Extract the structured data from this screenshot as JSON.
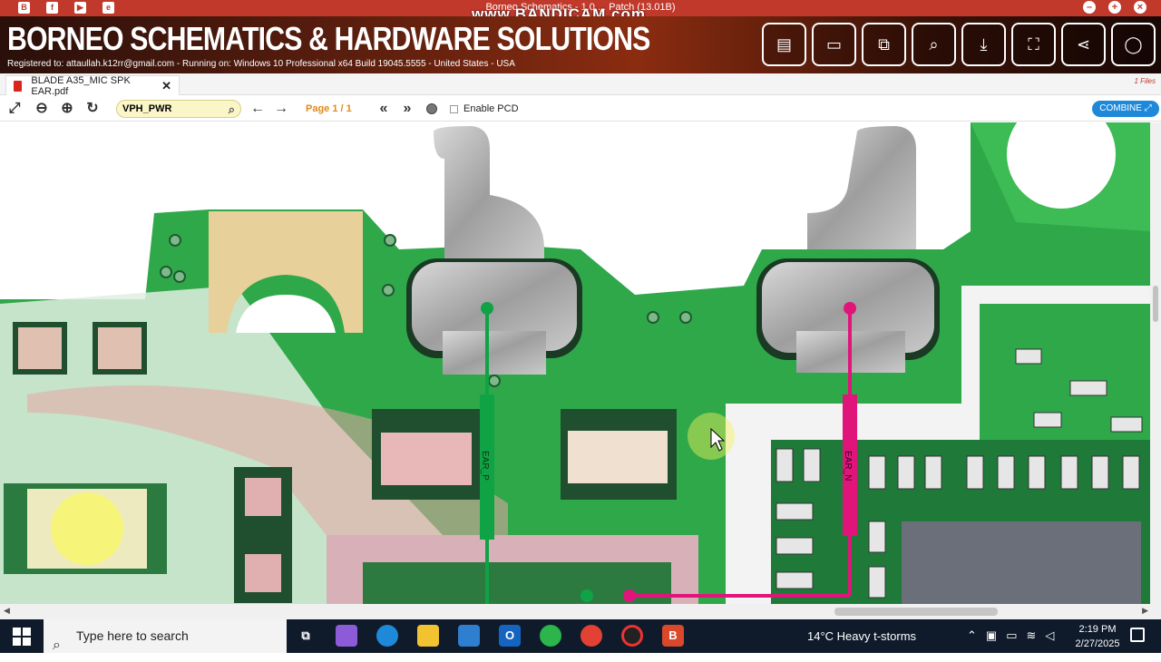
{
  "window": {
    "title": "Borneo Schematics - 1.0 ... Patch (13.01B)",
    "watermark": "www.BANDICAM.com"
  },
  "banner": {
    "brand": "BORNEO SCHEMATICS & HARDWARE SOLUTIONS",
    "registration": "Registered to: attaullah.k12rr@gmail.com - Running on: Windows 10 Professional x64 Build 19045.5555 - United States - USA",
    "buttons": [
      "schematic-list-icon",
      "laptop-icon",
      "devices-icon",
      "search-zoom-icon",
      "download-icon",
      "screenshot-icon",
      "share-icon",
      "user-icon"
    ]
  },
  "tab": {
    "filename": "BLADE A35_MIC SPK EAR.pdf",
    "close": "✕",
    "files_indicator": "1 Files"
  },
  "toolbar": {
    "search_value": "VPH_PWR",
    "page": "Page 1 / 1",
    "prev_page": "«",
    "next_page": "»",
    "enable_pcd": "Enable PCD",
    "combine": "COMBINE"
  },
  "board": {
    "nets": [
      {
        "label": "EAR_P",
        "color": "#0fa345"
      },
      {
        "label": "EAR_N",
        "color": "#e0157a"
      }
    ]
  },
  "taskbar": {
    "search_placeholder": "Type here to search",
    "weather": "14°C  Heavy t-storms",
    "time": "2:19 PM",
    "date": "2/27/2025"
  }
}
